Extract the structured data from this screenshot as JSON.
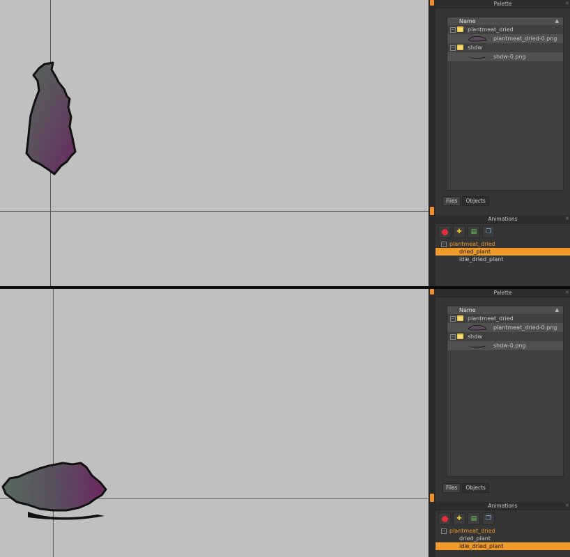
{
  "panes": [
    {
      "palette": {
        "title": "Palette",
        "column_header": "Name",
        "items": [
          {
            "label": "plantmeat_dried",
            "type": "folder"
          },
          {
            "label": "plantmeat_dried-0.png",
            "type": "file"
          },
          {
            "label": "shdw",
            "type": "folder"
          },
          {
            "label": "shdw-0.png",
            "type": "file"
          }
        ],
        "tabs": [
          "Files",
          "Objects"
        ]
      },
      "animations": {
        "title": "Animations",
        "group": "plantmeat_dried",
        "items": [
          "dried_plant",
          "idle_dried_plant"
        ],
        "selected": "dried_plant"
      }
    },
    {
      "palette": {
        "title": "Palette",
        "column_header": "Name",
        "items": [
          {
            "label": "plantmeat_dried",
            "type": "folder"
          },
          {
            "label": "plantmeat_dried-0.png",
            "type": "file"
          },
          {
            "label": "shdw",
            "type": "folder"
          },
          {
            "label": "shdw-0.png",
            "type": "file"
          }
        ],
        "tabs": [
          "Files",
          "Objects"
        ]
      },
      "animations": {
        "title": "Animations",
        "group": "plantmeat_dried",
        "items": [
          "dried_plant",
          "idle_dried_plant"
        ],
        "selected": "idle_dried_plant"
      }
    }
  ],
  "icons": {
    "close": "close-icon",
    "delete": "delete-animation-icon",
    "add": "add-animation-icon",
    "duplicate": "duplicate-animation-icon",
    "copy": "copy-animation-icon"
  },
  "colors": {
    "canvas_bg": "#c0c0c0",
    "accent": "#f09a2a",
    "panel_bg": "#353535"
  }
}
